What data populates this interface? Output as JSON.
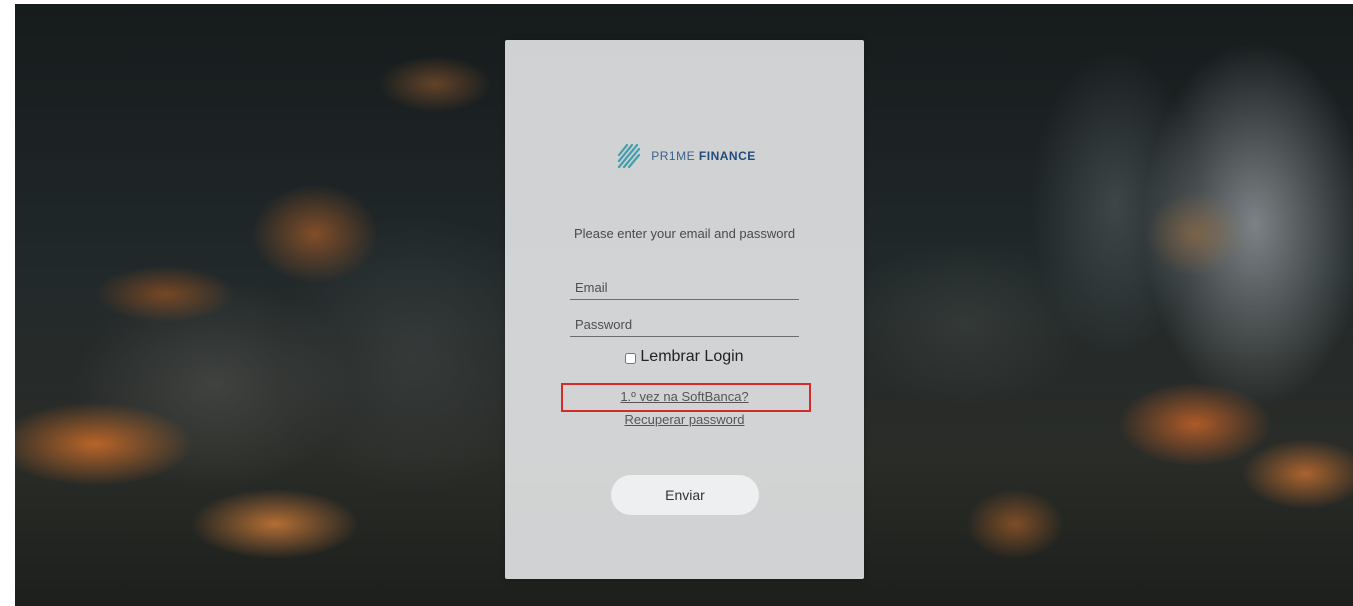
{
  "brand": {
    "logo_icon": "prime-finance-stripes-logo",
    "name_light": "PR1ME",
    "name_bold": "FINANCE",
    "colors": [
      "#4fb6a8",
      "#2f8fc0",
      "#214c7a"
    ]
  },
  "login": {
    "instructions": "Please enter your email and password",
    "email_placeholder": "Email",
    "password_placeholder": "Password",
    "remember_label": "Lembrar Login",
    "first_time_link": "1.º vez na SoftBanca?",
    "recover_link": "Recuperar password",
    "submit_label": "Enviar"
  },
  "annotation": {
    "highlight_color": "#d42a2a"
  }
}
